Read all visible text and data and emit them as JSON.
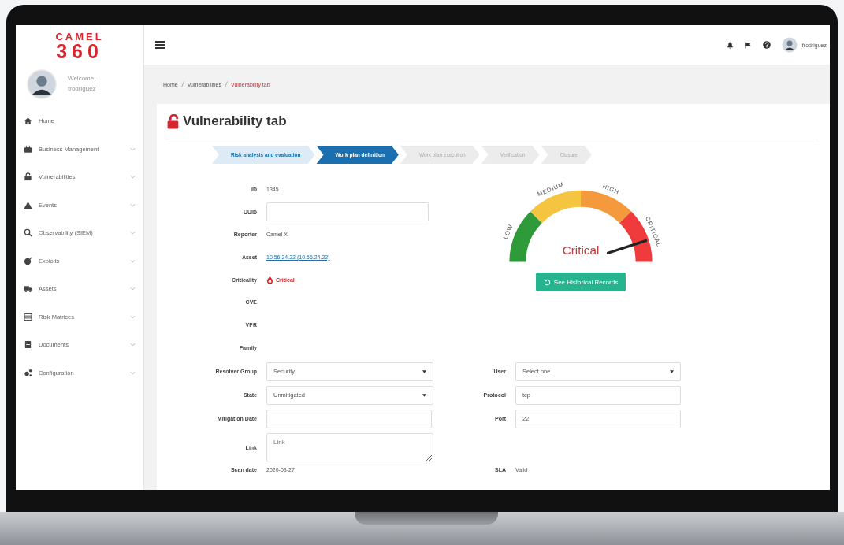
{
  "logo": {
    "line_1": "CAMEL",
    "line_2": "360"
  },
  "user_panel": {
    "greeting": "Welcome,",
    "username": "frodriguez"
  },
  "sidebar": {
    "items": [
      {
        "label": "Home",
        "expandable": false,
        "selected": false
      },
      {
        "label": "Business Management",
        "expandable": true,
        "selected": false
      },
      {
        "label": "Vulnerabilities",
        "expandable": true,
        "selected": false
      },
      {
        "label": "Events",
        "expandable": true,
        "selected": false
      },
      {
        "label": "Observability (SIEM)",
        "expandable": true,
        "selected": false
      },
      {
        "label": "Exploits",
        "expandable": true,
        "selected": false
      },
      {
        "label": "Assets",
        "expandable": true,
        "selected": false
      },
      {
        "label": "Risk Matrices",
        "expandable": true,
        "selected": false
      },
      {
        "label": "Documents",
        "expandable": true,
        "selected": false
      },
      {
        "label": "Configuration",
        "expandable": true,
        "selected": false
      }
    ]
  },
  "header": {
    "username": "frodriguez"
  },
  "breadcrumb": [
    "Home",
    "Vulnerabilities",
    "Vulnerability tab"
  ],
  "page_title": "Vulnerability tab",
  "steps": [
    {
      "label": "Risk analysis and evaluation",
      "done": true,
      "selected": false
    },
    {
      "label": "Work plan definition",
      "done": false,
      "selected": true
    },
    {
      "label": "Work plan execution",
      "done": false,
      "selected": false
    },
    {
      "label": "Verification",
      "done": false,
      "selected": false
    },
    {
      "label": "Closure",
      "done": false,
      "selected": false
    }
  ],
  "details": [
    {
      "label": "ID",
      "kind": "text",
      "value": "1345"
    },
    {
      "label": "UUID",
      "kind": "input"
    },
    {
      "label": "Reporter",
      "kind": "text",
      "value": "Camel X"
    },
    {
      "label": "Asset",
      "kind": "link",
      "value": "10.56.24.22 (10.56.24.22)"
    },
    {
      "label": "Criticality",
      "kind": "badge",
      "value": "Critical"
    },
    {
      "label": "CVE",
      "kind": "text"
    },
    {
      "label": "VPR",
      "kind": "text"
    },
    {
      "label": "Family",
      "kind": "text"
    }
  ],
  "gauge": {
    "level": 0.9,
    "reading": "Critical",
    "segments": [
      {
        "label": "LOW",
        "color": "#2e9a3a"
      },
      {
        "label": "MEDIUM",
        "color": "#f5c542"
      },
      {
        "label": "HIGH",
        "color": "#f59a3c"
      },
      {
        "label": "CRITICAL",
        "color": "#ef3b3b"
      }
    ]
  },
  "history_button": "See Historical Records",
  "form_rows": [
    {
      "left": {
        "label": "Resolver Group",
        "kind": "select",
        "value": "Security"
      },
      "right": {
        "label": "User",
        "kind": "select",
        "value": "Select one"
      }
    },
    {
      "left": {
        "label": "State",
        "kind": "select",
        "value": "Unmitigated"
      },
      "right": {
        "label": "Protocol",
        "kind": "input",
        "value": "tcp"
      }
    },
    {
      "left": {
        "label": "Mitigation Date",
        "kind": "input"
      },
      "right": {
        "label": "Port",
        "kind": "input",
        "value": "22"
      }
    },
    {
      "left": {
        "label": "Link",
        "kind": "textarea",
        "placeholder": "Link"
      }
    },
    {
      "left": {
        "label": "Scan date",
        "kind": "text",
        "value": "2020-03-27"
      },
      "right": {
        "label": "SLA",
        "kind": "text",
        "value": "Valid"
      }
    }
  ]
}
